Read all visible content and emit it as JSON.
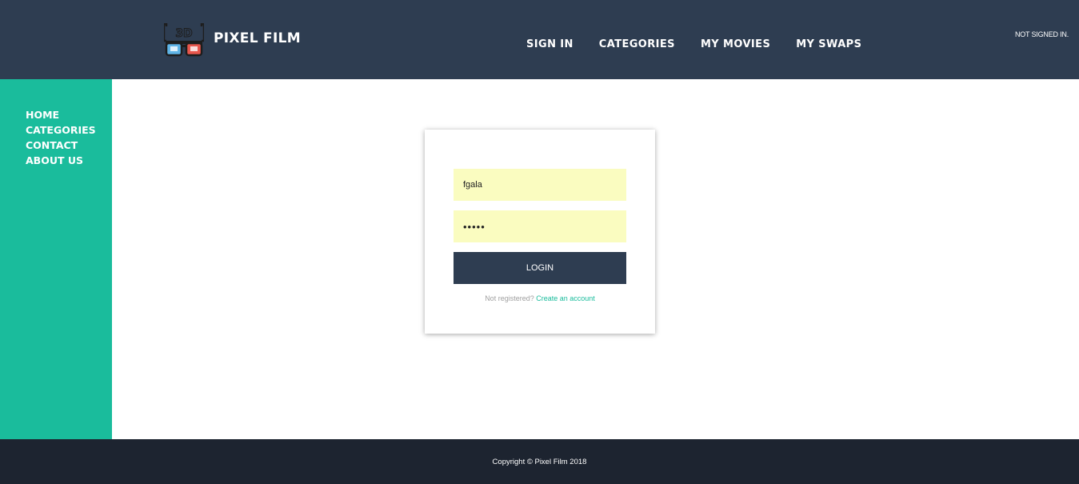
{
  "header": {
    "brand": "PIXEL FILM",
    "logo_icon": "3d-glasses-icon",
    "status": "NOT SIGNED IN.",
    "nav": [
      {
        "label": "SIGN IN"
      },
      {
        "label": "CATEGORIES"
      },
      {
        "label": "MY MOVIES"
      },
      {
        "label": "MY SWAPS"
      }
    ]
  },
  "sidebar": {
    "items": [
      {
        "label": "HOME"
      },
      {
        "label": "CATEGORIES"
      },
      {
        "label": "CONTACT"
      },
      {
        "label": "ABOUT US"
      }
    ]
  },
  "login": {
    "username_value": "fgala",
    "password_value": "•••••",
    "button_label": "LOGIN",
    "register_prompt": "Not registered?",
    "register_link": "Create an account"
  },
  "footer": {
    "copyright": "Copyright © Pixel Film 2018"
  },
  "colors": {
    "header_bg": "#2e3d51",
    "sidebar_bg": "#1abc9c",
    "input_bg": "#fafcc0",
    "footer_bg": "#1d2430",
    "accent": "#1abc9c"
  }
}
